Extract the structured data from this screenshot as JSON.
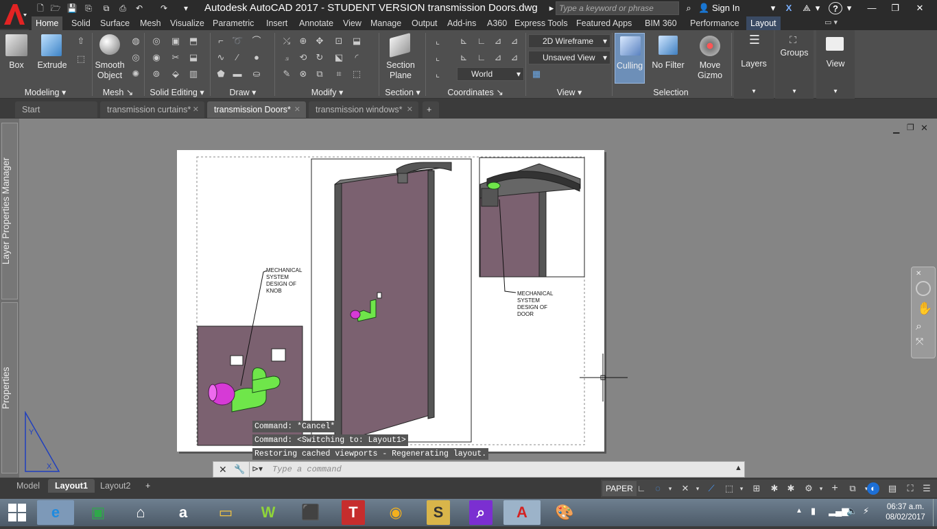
{
  "app": {
    "title": "Autodesk AutoCAD 2017 - STUDENT VERSION    transmission Doors.dwg",
    "logo": "A",
    "search_placeholder": "Type a keyword or phrase",
    "sign_in": "Sign In",
    "help": "?"
  },
  "ribbon_tabs": [
    "Home",
    "Solid",
    "Surface",
    "Mesh",
    "Visualize",
    "Parametric",
    "Insert",
    "Annotate",
    "View",
    "Manage",
    "Output",
    "Add-ins",
    "A360",
    "Express Tools",
    "Featured Apps",
    "BIM 360",
    "Performance",
    "Layout"
  ],
  "ribbon": {
    "box": "Box",
    "extrude": "Extrude",
    "smooth_object": "Smooth\nObject",
    "section_plane": "Section\nPlane",
    "visual_style": "2D Wireframe",
    "view_name": "Unsaved View",
    "ucs": "World",
    "culling": "Culling",
    "no_filter": "No Filter",
    "move_gizmo": "Move\nGizmo",
    "layers": "Layers",
    "groups": "Groups",
    "view": "View",
    "panels": [
      "Modeling",
      "Mesh",
      "Solid Editing",
      "Draw",
      "Modify",
      "Section",
      "Coordinates",
      "View",
      "Selection"
    ]
  },
  "doc_tabs": [
    {
      "label": "Start",
      "active": false
    },
    {
      "label": "transmission curtains*",
      "active": false
    },
    {
      "label": "transmission Doors*",
      "active": true
    },
    {
      "label": "transmission windows*",
      "active": false
    }
  ],
  "palettes": {
    "layer_manager": "Layer Properties Manager",
    "properties": "Properties"
  },
  "drawing": {
    "note_knob": "MECHANICAL\nSYSTEM\nDESIGN OF\nKNOB",
    "note_door": "MECHANICAL\nSYSTEM\nDESIGN OF\nDOOR"
  },
  "command": {
    "history": [
      "Command: *Cancel*",
      "Command:   <Switching to: Layout1>",
      "Restoring cached viewports - Regenerating layout."
    ],
    "placeholder": "Type a command"
  },
  "layout_tabs": [
    {
      "label": "Model",
      "active": false
    },
    {
      "label": "Layout1",
      "active": true
    },
    {
      "label": "Layout2",
      "active": false
    }
  ],
  "status": {
    "space": "PAPER"
  },
  "clock": {
    "time": "06:37 a.m.",
    "date": "08/02/2017"
  },
  "colors": {
    "door_panel": "#7b6170",
    "knob_green": "#6fe64a",
    "knob_magenta": "#d63ad6",
    "frame_gray": "#555555"
  }
}
